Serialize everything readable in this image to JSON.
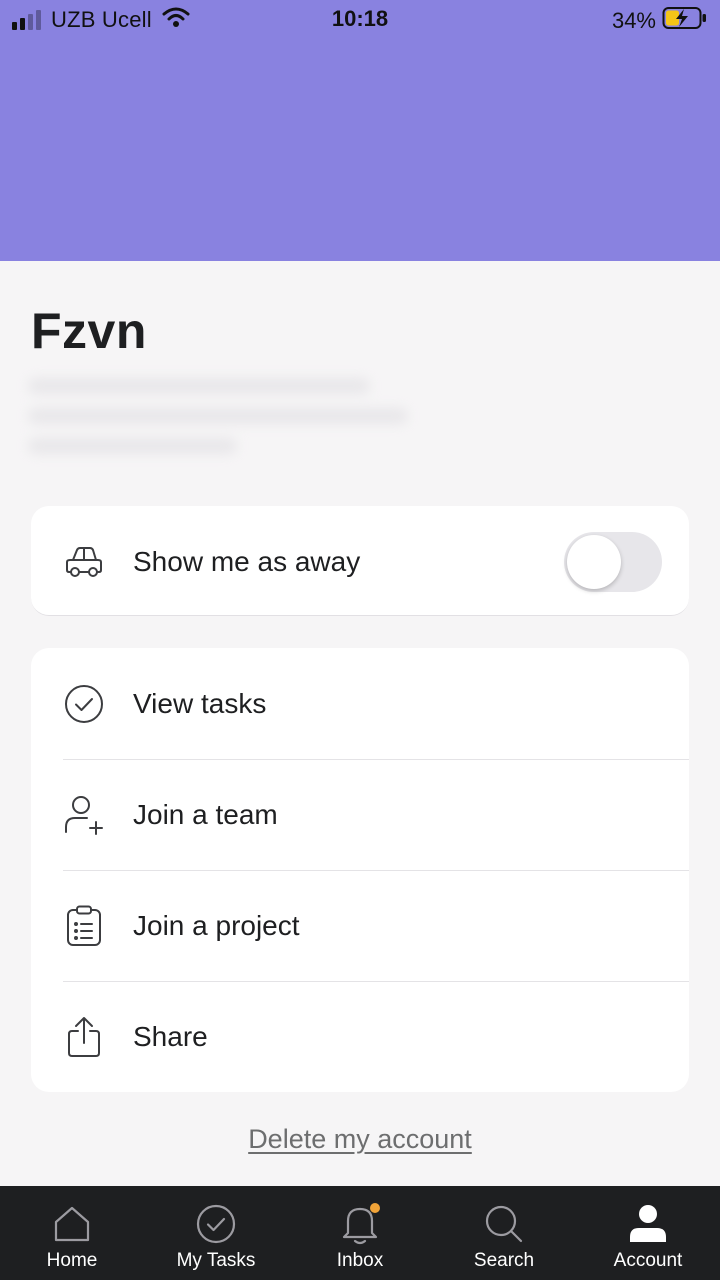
{
  "status_bar": {
    "carrier": "UZB Ucell",
    "time": "10:18",
    "battery_percent": "34%"
  },
  "profile": {
    "name": "Fzvn"
  },
  "away_setting": {
    "label": "Show me as away",
    "enabled": false
  },
  "menu": {
    "items": [
      {
        "label": "View tasks",
        "icon": "check-circle-icon"
      },
      {
        "label": "Join a team",
        "icon": "user-plus-icon"
      },
      {
        "label": "Join a project",
        "icon": "clipboard-list-icon"
      },
      {
        "label": "Share",
        "icon": "share-icon"
      }
    ]
  },
  "delete_account": {
    "label": "Delete my account"
  },
  "bottom_nav": {
    "items": [
      {
        "label": "Home",
        "icon": "home-icon"
      },
      {
        "label": "My Tasks",
        "icon": "check-circle-icon"
      },
      {
        "label": "Inbox",
        "icon": "bell-icon"
      },
      {
        "label": "Search",
        "icon": "search-icon"
      },
      {
        "label": "Account",
        "icon": "account-icon"
      }
    ],
    "active": "Account"
  },
  "colors": {
    "header": "#8982e0",
    "background": "#f6f5f6",
    "nav_background": "#1e1f21",
    "notification_dot": "#f1a338",
    "battery_charging": "#f5c518"
  }
}
